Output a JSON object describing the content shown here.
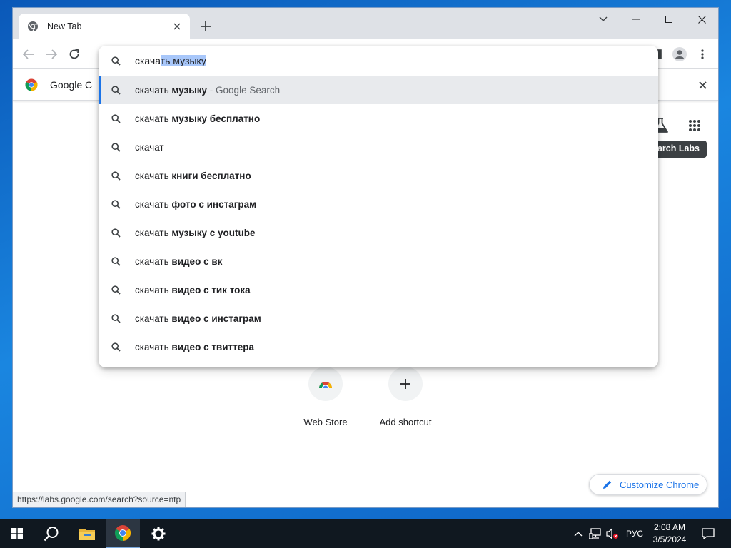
{
  "browser": {
    "tab": {
      "title": "New Tab"
    },
    "infobar": {
      "text": "Google C"
    },
    "status_url": "https://labs.google.com/search?source=ntp"
  },
  "omnibox": {
    "typed": "скача",
    "selected": "ть музыку",
    "suggestions": [
      {
        "prefix": "скачать ",
        "bold": "музыку",
        "suffix": " - Google Search",
        "active": true
      },
      {
        "prefix": "скачать ",
        "bold": "музыку бесплатно",
        "suffix": ""
      },
      {
        "prefix": "скачат",
        "bold": "",
        "suffix": ""
      },
      {
        "prefix": "скачать ",
        "bold": "книги бесплатно",
        "suffix": ""
      },
      {
        "prefix": "скачать ",
        "bold": "фото с инстаграм",
        "suffix": ""
      },
      {
        "prefix": "скачать ",
        "bold": "музыку с youtube",
        "suffix": ""
      },
      {
        "prefix": "скачать ",
        "bold": "видео с вк",
        "suffix": ""
      },
      {
        "prefix": "скачать ",
        "bold": "видео с тик тока",
        "suffix": ""
      },
      {
        "prefix": "скачать ",
        "bold": "видео с инстаграм",
        "suffix": ""
      },
      {
        "prefix": "скачать ",
        "bold": "видео с твиттера",
        "suffix": ""
      }
    ]
  },
  "ntp": {
    "labs_tooltip": "Search Labs",
    "shortcuts": [
      {
        "label": "Web Store",
        "icon": "chrome-web-store-icon"
      },
      {
        "label": "Add shortcut",
        "icon": "plus-icon"
      }
    ],
    "customize_label": "Customize Chrome"
  },
  "taskbar": {
    "language": "РУС",
    "time": "2:08 AM",
    "date": "3/5/2024"
  },
  "colors": {
    "accent": "#1a73e8",
    "selection": "#a8c7fa",
    "active_row": "#e8eaed",
    "taskbar": "#101820"
  }
}
